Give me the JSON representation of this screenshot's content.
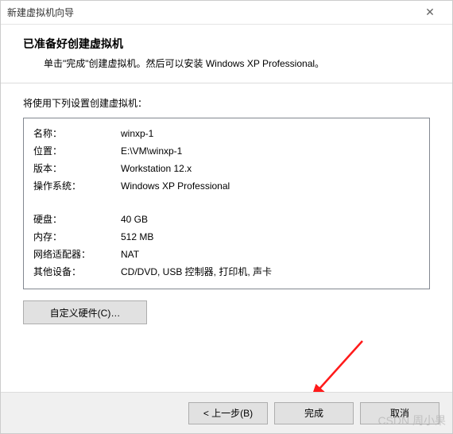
{
  "window": {
    "title": "新建虚拟机向导"
  },
  "header": {
    "heading": "已准备好创建虚拟机",
    "sub": "单击\"完成\"创建虚拟机。然后可以安装 Windows XP Professional。"
  },
  "intro": "将使用下列设置创建虚拟机：",
  "rows": [
    {
      "label": "名称：",
      "value": "winxp-1"
    },
    {
      "label": "位置：",
      "value": "E:\\VM\\winxp-1"
    },
    {
      "label": "版本：",
      "value": "Workstation 12.x"
    },
    {
      "label": "操作系统：",
      "value": "Windows XP Professional"
    }
  ],
  "rows2": [
    {
      "label": "硬盘：",
      "value": "40 GB"
    },
    {
      "label": "内存：",
      "value": "512 MB"
    },
    {
      "label": "网络适配器：",
      "value": "NAT"
    },
    {
      "label": "其他设备：",
      "value": "CD/DVD, USB 控制器, 打印机, 声卡"
    }
  ],
  "buttons": {
    "customize": "自定义硬件(C)…",
    "back": "< 上一步(B)",
    "finish": "完成",
    "cancel": "取消"
  },
  "watermark": "CSDN 周小果"
}
